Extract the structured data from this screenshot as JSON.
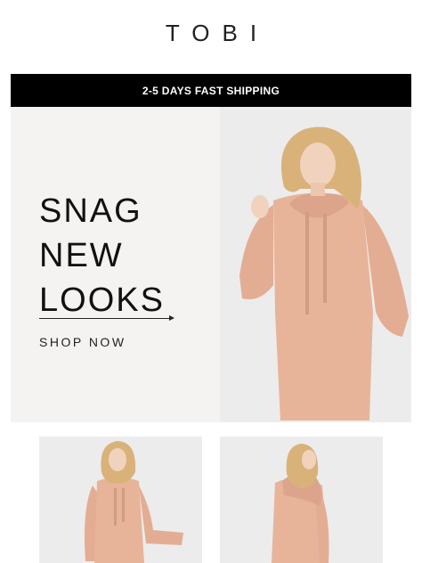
{
  "header": {
    "brand": "TOBI"
  },
  "banner": {
    "shipping_text": "2-5 DAYS FAST SHIPPING"
  },
  "hero": {
    "headline_lines": [
      "SNAG",
      "NEW",
      "LOOKS"
    ],
    "cta_label": "SHOP NOW"
  },
  "photos": {
    "main": "model-hoodie-dress-front",
    "secondary_a": "model-hoodie-dress-front-full",
    "secondary_b": "model-hoodie-dress-back"
  },
  "colors": {
    "banner_bg": "#000000",
    "hero_bg": "#f4f3f2",
    "dress": "#e7b49a",
    "hair": "#d9b27a"
  }
}
